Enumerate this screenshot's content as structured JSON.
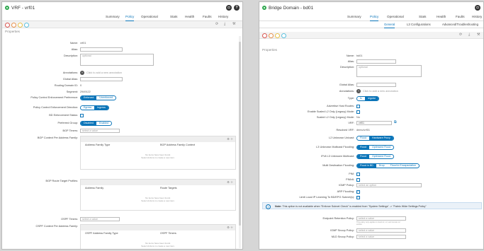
{
  "left": {
    "title": "VRF - vrf01",
    "tabs": [
      "Summary",
      "Policy",
      "Operational",
      "Stats",
      "Health",
      "Faults",
      "History"
    ],
    "active_tab": "Policy",
    "properties": "Properties",
    "fields": {
      "name_label": "Name:",
      "name": "vrf01",
      "alias_label": "Alias:",
      "desc_label": "Description:",
      "desc_placeholder": "optional",
      "annot_label": "Annotations:",
      "annot_text": "Click to add a new annotation",
      "galias_label": "Global Alias:",
      "rdid_label": "Routing Domain ID:",
      "rdid": "0",
      "segment_label": "Segment:",
      "segment": "2949122",
      "pcep_label": "Policy Control Enforcement Preference:",
      "pcep_opts": [
        "Enforced",
        "Unenforced"
      ],
      "pced_label": "Policy Control Enforcement Direction:",
      "pced_opts": [
        "Egress",
        "Ingress"
      ],
      "bd_label": "BD Enforcement Status:",
      "pg_label": "Preferred Group:",
      "pg_opts": [
        "Disabled",
        "Enabled"
      ],
      "bgpt_label": "BGP Timers:",
      "bgpt_placeholder": "select a value",
      "bgpctx_label": "BGP Context Per Address Family:",
      "bgpctx_cols": [
        "Address Family Type",
        "BGP Address Family Context"
      ],
      "empty1": "No items have been found.",
      "empty2": "Select Actions to create a new item.",
      "bgprt_label": "BGP Route Target Profiles:",
      "bgprt_cols": [
        "Address Family",
        "Route Targets"
      ],
      "ospft_label": "OSPF Timers:",
      "ospft_placeholder": "select a value",
      "ospfctx_label": "OSPF Context Per Address Family:",
      "ospfctx_cols": [
        "OSPF Address Family Type",
        "OSPF Timers"
      ]
    }
  },
  "right": {
    "title": "Bridge Domain - bd01",
    "tabs": [
      "Summary",
      "Policy",
      "Operational",
      "Stats",
      "Health",
      "Faults",
      "History"
    ],
    "active_tab": "Policy",
    "subtabs": [
      "General",
      "L3 Configurations",
      "Advanced/Troubleshooting"
    ],
    "properties": "Properties",
    "fields": {
      "name_label": "Name:",
      "name": "bd01",
      "alias_label": "Alias:",
      "desc_label": "Description:",
      "desc_placeholder": "optional",
      "galias_label": "Global Alias:",
      "annot_label": "Annotations:",
      "annot_text": "Click to add a new annotation",
      "type_label": "Type:",
      "type_opts": [
        "fc",
        "regular"
      ],
      "aho_label": "Advertise Host Routes:",
      "esl2_label": "Enable Scaled L2 Only (Legacy) Mode:",
      "sl2_label": "Scaled L2 Only (Legacy) Mode:",
      "sl2": "No",
      "vrf_label": "VRF:",
      "vrf": "vrf01",
      "rvrf_label": "Resolved VRF:",
      "rvrf": "demo/vrf01",
      "l2u_label": "L2 Unknown Unicast:",
      "l2u_opts": [
        "Flood",
        "Hardware Proxy"
      ],
      "l3m_label": "L3 Unknown Multicast Flooding:",
      "l3m_opts": [
        "Flood",
        "Optimized Flood"
      ],
      "v6m_label": "IPv6 L3 Unknown Multicast:",
      "v6m_opts": [
        "Flood",
        "Optimized Flood"
      ],
      "mdf_label": "Multi Destination Flooding:",
      "mdf_opts": [
        "Flood in BD",
        "Drop",
        "Flood in Encapsulation"
      ],
      "pim_label": "PIM:",
      "pimv6_label": "PIMv6:",
      "igmp_label": "IGMP Policy:",
      "igmp_placeholder": "select an option",
      "arp_label": "ARP Flooding:",
      "lli_label": "Limit Local IP Learning To BD/EPG Subnet(s):",
      "note_bold": "Note:",
      "note_text": " This option is not available when \"Enforce Subnet Check\" is enabled from \"System Settings\" -> \"Fabric Wide Settings Policy\"",
      "erp_label": "Endpoint Retention Policy:",
      "erp_placeholder": "select a value",
      "erp_hint": "This policy only applies to local L2, L3, and remote L2 entries",
      "igmps_label": "IGMP Snoop Policy:",
      "igmps_placeholder": "select a value",
      "mlds_label": "MLD Snoop Policy:",
      "mlds_placeholder": "select a value"
    }
  },
  "colors": {
    "accent": "#0a74b8",
    "ok": "#2fa84f"
  }
}
